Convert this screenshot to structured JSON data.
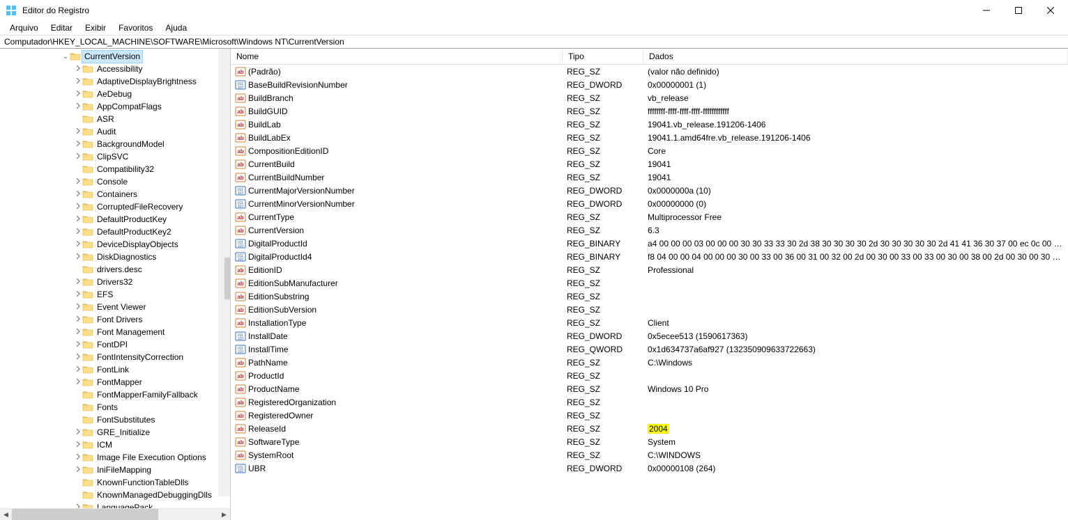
{
  "window": {
    "title": "Editor do Registro"
  },
  "menu": {
    "arquivo": "Arquivo",
    "editar": "Editar",
    "exibir": "Exibir",
    "favoritos": "Favoritos",
    "ajuda": "Ajuda"
  },
  "address": "Computador\\HKEY_LOCAL_MACHINE\\SOFTWARE\\Microsoft\\Windows NT\\CurrentVersion",
  "tree": {
    "selected_label": "CurrentVersion",
    "children": [
      {
        "label": "Accessibility",
        "exp": true
      },
      {
        "label": "AdaptiveDisplayBrightness",
        "exp": true
      },
      {
        "label": "AeDebug",
        "exp": true
      },
      {
        "label": "AppCompatFlags",
        "exp": true
      },
      {
        "label": "ASR",
        "exp": false
      },
      {
        "label": "Audit",
        "exp": true
      },
      {
        "label": "BackgroundModel",
        "exp": true
      },
      {
        "label": "ClipSVC",
        "exp": true
      },
      {
        "label": "Compatibility32",
        "exp": false
      },
      {
        "label": "Console",
        "exp": true
      },
      {
        "label": "Containers",
        "exp": true
      },
      {
        "label": "CorruptedFileRecovery",
        "exp": true
      },
      {
        "label": "DefaultProductKey",
        "exp": true
      },
      {
        "label": "DefaultProductKey2",
        "exp": true
      },
      {
        "label": "DeviceDisplayObjects",
        "exp": true
      },
      {
        "label": "DiskDiagnostics",
        "exp": true
      },
      {
        "label": "drivers.desc",
        "exp": false
      },
      {
        "label": "Drivers32",
        "exp": true
      },
      {
        "label": "EFS",
        "exp": true
      },
      {
        "label": "Event Viewer",
        "exp": true
      },
      {
        "label": "Font Drivers",
        "exp": true
      },
      {
        "label": "Font Management",
        "exp": true
      },
      {
        "label": "FontDPI",
        "exp": true
      },
      {
        "label": "FontIntensityCorrection",
        "exp": true
      },
      {
        "label": "FontLink",
        "exp": true
      },
      {
        "label": "FontMapper",
        "exp": true
      },
      {
        "label": "FontMapperFamilyFallback",
        "exp": false
      },
      {
        "label": "Fonts",
        "exp": false
      },
      {
        "label": "FontSubstitutes",
        "exp": false
      },
      {
        "label": "GRE_Initialize",
        "exp": true
      },
      {
        "label": "ICM",
        "exp": true
      },
      {
        "label": "Image File Execution Options",
        "exp": true
      },
      {
        "label": "IniFileMapping",
        "exp": true
      },
      {
        "label": "KnownFunctionTableDlls",
        "exp": false
      },
      {
        "label": "KnownManagedDebuggingDlls",
        "exp": false
      },
      {
        "label": "LanguagePack",
        "exp": true
      }
    ]
  },
  "columns": {
    "name": "Nome",
    "type": "Tipo",
    "data": "Dados"
  },
  "values": [
    {
      "name": "(Padrão)",
      "type": "REG_SZ",
      "data": "(valor não definido)",
      "icon": "sz"
    },
    {
      "name": "BaseBuildRevisionNumber",
      "type": "REG_DWORD",
      "data": "0x00000001 (1)",
      "icon": "bin"
    },
    {
      "name": "BuildBranch",
      "type": "REG_SZ",
      "data": "vb_release",
      "icon": "sz"
    },
    {
      "name": "BuildGUID",
      "type": "REG_SZ",
      "data": "ffffffff-ffff-ffff-ffff-ffffffffffff",
      "icon": "sz"
    },
    {
      "name": "BuildLab",
      "type": "REG_SZ",
      "data": "19041.vb_release.191206-1406",
      "icon": "sz"
    },
    {
      "name": "BuildLabEx",
      "type": "REG_SZ",
      "data": "19041.1.amd64fre.vb_release.191206-1406",
      "icon": "sz"
    },
    {
      "name": "CompositionEditionID",
      "type": "REG_SZ",
      "data": "Core",
      "icon": "sz"
    },
    {
      "name": "CurrentBuild",
      "type": "REG_SZ",
      "data": "19041",
      "icon": "sz"
    },
    {
      "name": "CurrentBuildNumber",
      "type": "REG_SZ",
      "data": "19041",
      "icon": "sz"
    },
    {
      "name": "CurrentMajorVersionNumber",
      "type": "REG_DWORD",
      "data": "0x0000000a (10)",
      "icon": "bin"
    },
    {
      "name": "CurrentMinorVersionNumber",
      "type": "REG_DWORD",
      "data": "0x00000000 (0)",
      "icon": "bin"
    },
    {
      "name": "CurrentType",
      "type": "REG_SZ",
      "data": "Multiprocessor Free",
      "icon": "sz"
    },
    {
      "name": "CurrentVersion",
      "type": "REG_SZ",
      "data": "6.3",
      "icon": "sz"
    },
    {
      "name": "DigitalProductId",
      "type": "REG_BINARY",
      "data": "a4 00 00 00 03 00 00 00 30 30 33 33 30 2d 38 30 30 30 30 2d 30 30 30 30 30 2d 41 41 36 30 37 00 ec 0c 00 00 5b ...",
      "icon": "bin"
    },
    {
      "name": "DigitalProductId4",
      "type": "REG_BINARY",
      "data": "f8 04 00 00 04 00 00 00 30 00 33 00 36 00 31 00 32 00 2d 00 30 00 33 00 33 00 30 00 38 00 2d 00 30 00 30 00 30 0...",
      "icon": "bin"
    },
    {
      "name": "EditionID",
      "type": "REG_SZ",
      "data": "Professional",
      "icon": "sz"
    },
    {
      "name": "EditionSubManufacturer",
      "type": "REG_SZ",
      "data": "",
      "icon": "sz"
    },
    {
      "name": "EditionSubstring",
      "type": "REG_SZ",
      "data": "",
      "icon": "sz"
    },
    {
      "name": "EditionSubVersion",
      "type": "REG_SZ",
      "data": "",
      "icon": "sz"
    },
    {
      "name": "InstallationType",
      "type": "REG_SZ",
      "data": "Client",
      "icon": "sz"
    },
    {
      "name": "InstallDate",
      "type": "REG_DWORD",
      "data": "0x5ecee513 (1590617363)",
      "icon": "bin"
    },
    {
      "name": "InstallTime",
      "type": "REG_QWORD",
      "data": "0x1d634737a6af927 (132350909633722663)",
      "icon": "bin"
    },
    {
      "name": "PathName",
      "type": "REG_SZ",
      "data": "C:\\Windows",
      "icon": "sz"
    },
    {
      "name": "ProductId",
      "type": "REG_SZ",
      "data": "",
      "icon": "sz"
    },
    {
      "name": "ProductName",
      "type": "REG_SZ",
      "data": "Windows 10 Pro",
      "icon": "sz"
    },
    {
      "name": "RegisteredOrganization",
      "type": "REG_SZ",
      "data": "",
      "icon": "sz"
    },
    {
      "name": "RegisteredOwner",
      "type": "REG_SZ",
      "data": "",
      "icon": "sz"
    },
    {
      "name": "ReleaseId",
      "type": "REG_SZ",
      "data": "2004",
      "icon": "sz",
      "highlight": true
    },
    {
      "name": "SoftwareType",
      "type": "REG_SZ",
      "data": "System",
      "icon": "sz"
    },
    {
      "name": "SystemRoot",
      "type": "REG_SZ",
      "data": "C:\\WINDOWS",
      "icon": "sz"
    },
    {
      "name": "UBR",
      "type": "REG_DWORD",
      "data": "0x00000108 (264)",
      "icon": "bin"
    }
  ]
}
